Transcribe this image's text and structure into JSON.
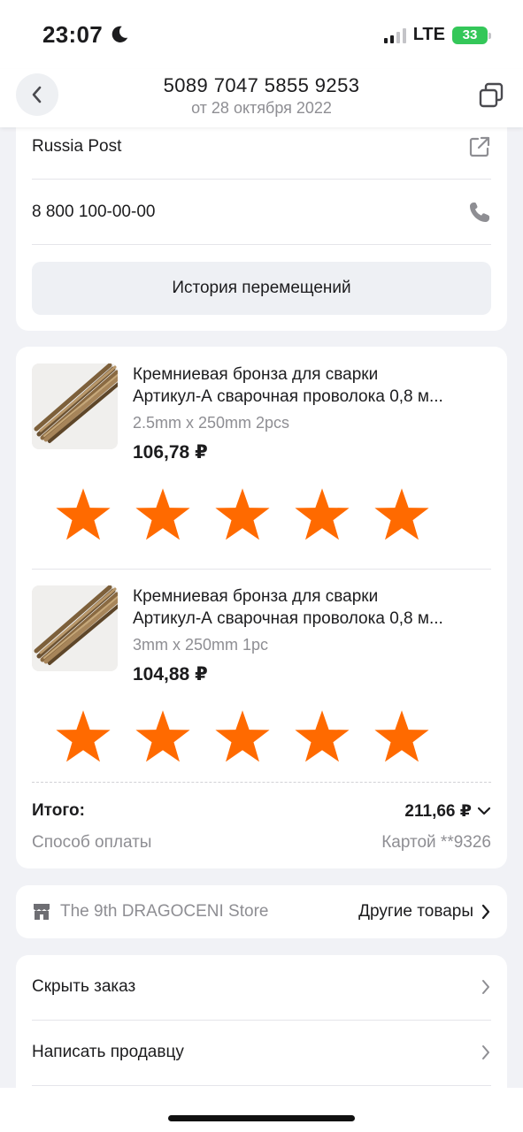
{
  "status_bar": {
    "time": "23:07",
    "network": "LTE",
    "battery": "33",
    "battery_color": "#34c759"
  },
  "header": {
    "tracking_number": "5089 7047 5855 9253",
    "date": "от 28 октября 2022"
  },
  "delivery": {
    "carrier": "Russia Post",
    "phone": "8 800 100-00-00",
    "history_button": "История перемещений"
  },
  "products": [
    {
      "title_line1": "Кремниевая бронза для сварки",
      "title_line2": "Артикул-А сварочная проволока 0,8 м...",
      "variant": "2.5mm x 250mm 2pcs",
      "price": "106,78 ₽",
      "rating": 5
    },
    {
      "title_line1": "Кремниевая бронза для сварки",
      "title_line2": "Артикул-А сварочная проволока 0,8 м...",
      "variant": "3mm x 250mm 1pc",
      "price": "104,88 ₽",
      "rating": 5
    }
  ],
  "summary": {
    "total_label": "Итого:",
    "total_value": "211,66 ₽",
    "payment_label": "Способ оплаты",
    "payment_value": "Картой **9326"
  },
  "store": {
    "name": "The 9th DRAGOCENI Store",
    "other_goods": "Другие товары"
  },
  "actions": {
    "hide_order": "Скрыть заказ",
    "write_seller": "Написать продавцу"
  },
  "colors": {
    "star": "#ff6a00",
    "background": "#f1f2f6"
  }
}
